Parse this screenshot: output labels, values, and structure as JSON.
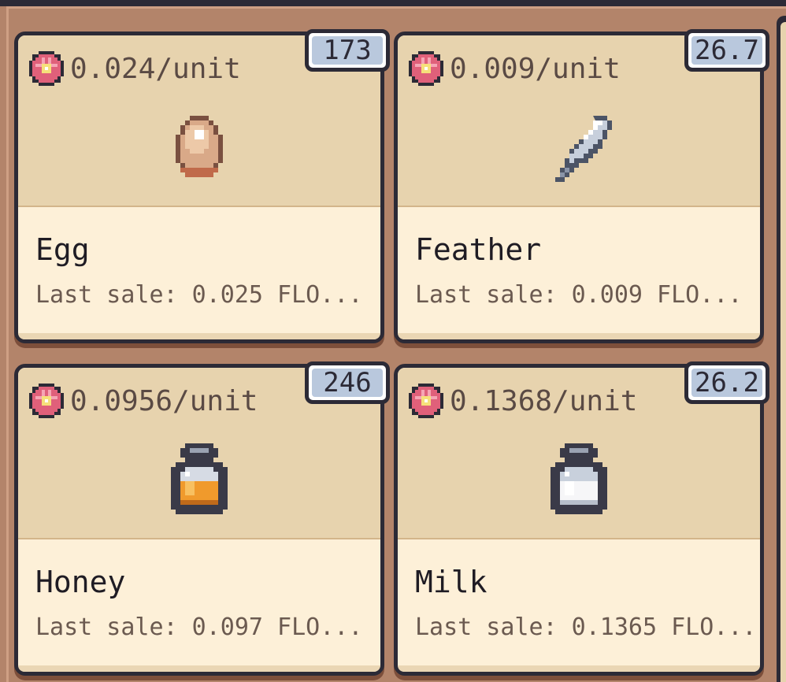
{
  "cards": [
    {
      "name": "Egg",
      "price": "0.024/unit",
      "count": "173",
      "last_sale": "Last sale: 0.025 FLO...",
      "icon": "egg-icon"
    },
    {
      "name": "Feather",
      "price": "0.009/unit",
      "count": "26.7",
      "last_sale": "Last sale: 0.009 FLO...",
      "icon": "feather-icon"
    },
    {
      "name": "Honey",
      "price": "0.0956/unit",
      "count": "246",
      "last_sale": "Last sale: 0.097 FLO...",
      "icon": "honey-jar-icon"
    },
    {
      "name": "Milk",
      "price": "0.1368/unit",
      "count": "26.2",
      "last_sale": "Last sale: 0.1365 FLO...",
      "icon": "milk-jar-icon"
    }
  ],
  "colors": {
    "card_top": "#e7d3ae",
    "card_bottom": "#fdf0d8",
    "badge": "#b9c8dd",
    "background": "#b3846a",
    "outline": "#2c2a36",
    "flower": "#e0607a"
  },
  "currency_icon": "flower-icon"
}
